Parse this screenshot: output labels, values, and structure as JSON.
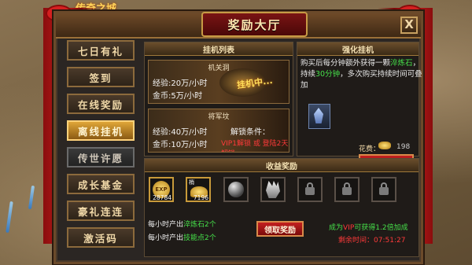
{
  "title": "奖励大厅",
  "close_label": "X",
  "sidebar": {
    "items": [
      {
        "label": "七日有礼"
      },
      {
        "label": "签到"
      },
      {
        "label": "在线奖励"
      },
      {
        "label": "离线挂机"
      },
      {
        "label": "传世许愿"
      },
      {
        "label": "成长基金"
      },
      {
        "label": "豪礼连连"
      },
      {
        "label": "激活码"
      }
    ]
  },
  "hang_list": {
    "header": "挂机列表",
    "card1": {
      "tag": "机关洞",
      "exp": "经验:20万/小时",
      "gold": "金币:5万/小时",
      "status": "挂机中..."
    },
    "card2": {
      "tag": "将军坟",
      "exp": "经验:40万/小时",
      "unlock_label": "解锁条件：",
      "gold": "金币:10万/小时",
      "unlock_cond": "VIP1解锁 或 登陆2天解锁"
    }
  },
  "strengthen": {
    "header": "强化挂机",
    "desc_1": "购买后每分钟额外获得一颗",
    "desc_green": "淬炼石",
    "desc_2": "，持续",
    "desc_green2": "30分钟",
    "desc_3": "，多次购买持续时间可叠加",
    "cost_label": "花费：",
    "cost_value": "198",
    "buy_label": "购买"
  },
  "rewards": {
    "header": "收益奖励",
    "slots": [
      {
        "icon": "exp-orb-icon",
        "count": "28784",
        "label": "EXP"
      },
      {
        "icon": "gold-pile-icon",
        "count": "7196",
        "label": "梢"
      },
      {
        "icon": "steel-ball-icon",
        "count": ""
      },
      {
        "icon": "claw-stone-icon",
        "count": ""
      },
      {
        "icon": "lock-icon",
        "count": ""
      },
      {
        "icon": "lock-icon",
        "count": ""
      },
      {
        "icon": "lock-icon",
        "count": ""
      }
    ],
    "line1_prefix": "每小时产出",
    "line1_item": "淬炼石2个",
    "line2_prefix": "每小时产出",
    "line2_item": "技能点2个",
    "claim_label": "领取奖励",
    "vip_prefix": "成为",
    "vip_word": "VIP",
    "vip_suffix": "可获得1.2倍加成",
    "remaining_label": "剩余时间：",
    "remaining_value": "07:51:27"
  },
  "logo_text": "传奇之城",
  "colors": {
    "accent_red": "#c42020",
    "accent_gold": "#e0a638",
    "text_green": "#46e04a",
    "text_red": "#ff3a3a"
  }
}
